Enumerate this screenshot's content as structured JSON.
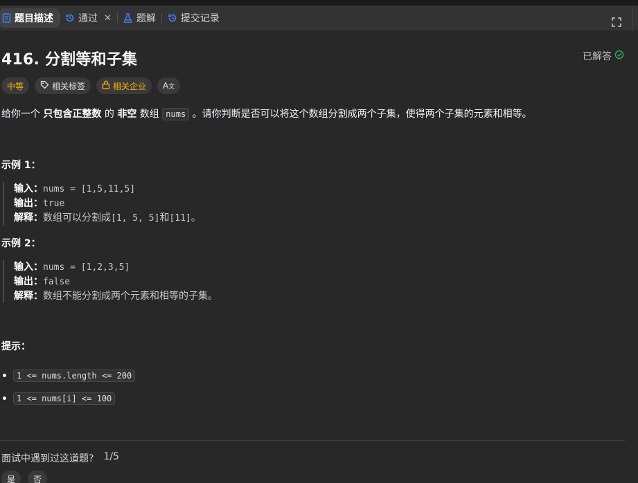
{
  "tabs": [
    {
      "label": "题目描述",
      "icon": "description-icon",
      "active": true
    },
    {
      "label": "通过",
      "icon": "history-icon",
      "closable": true
    },
    {
      "label": "题解",
      "icon": "flask-icon"
    },
    {
      "label": "提交记录",
      "icon": "history-icon"
    }
  ],
  "problem": {
    "title": "416. 分割等和子集",
    "status": "已解答",
    "tags": {
      "difficulty": "中等",
      "related_tags": "相关标签",
      "related_companies": "相关企业",
      "font_size": "A"
    },
    "description": {
      "p1": "给你一个 ",
      "b1": "只包含正整数",
      "p2": " 的 ",
      "b2": "非空",
      "p3": " 数组 ",
      "code": "nums",
      "p4": " 。请你判断是否可以将这个数组分割成两个子集，使得两个子集的元素和相等。"
    },
    "examples": [
      {
        "heading": "示例 1：",
        "input_label": "输入：",
        "input": "nums = [1,5,11,5]",
        "output_label": "输出：",
        "output": "true",
        "explain_label": "解释：",
        "explain_pre": "数组可以分割成",
        "explain_code1": " [1, 5, 5] ",
        "explain_mid": "和",
        "explain_code2": " [11] ",
        "explain_end": "。"
      },
      {
        "heading": "示例 2：",
        "input_label": "输入：",
        "input": "nums = [1,2,3,5]",
        "output_label": "输出：",
        "output": "false",
        "explain_label": "解释：",
        "explain": "数组不能分割成两个元素和相等的子集。"
      }
    ],
    "hints_heading": "提示：",
    "constraints": [
      "1 <= nums.length <= 200",
      "1 <= nums[i] <= 100"
    ]
  },
  "interview": {
    "question": "面试中遇到过这道题?",
    "progress": "1/5",
    "yes": "是",
    "no": "否"
  },
  "colors": {
    "tabbar": "#333333",
    "content_bg": "#282828",
    "medium": "#ffb800",
    "solved_check": "#2db55d"
  }
}
